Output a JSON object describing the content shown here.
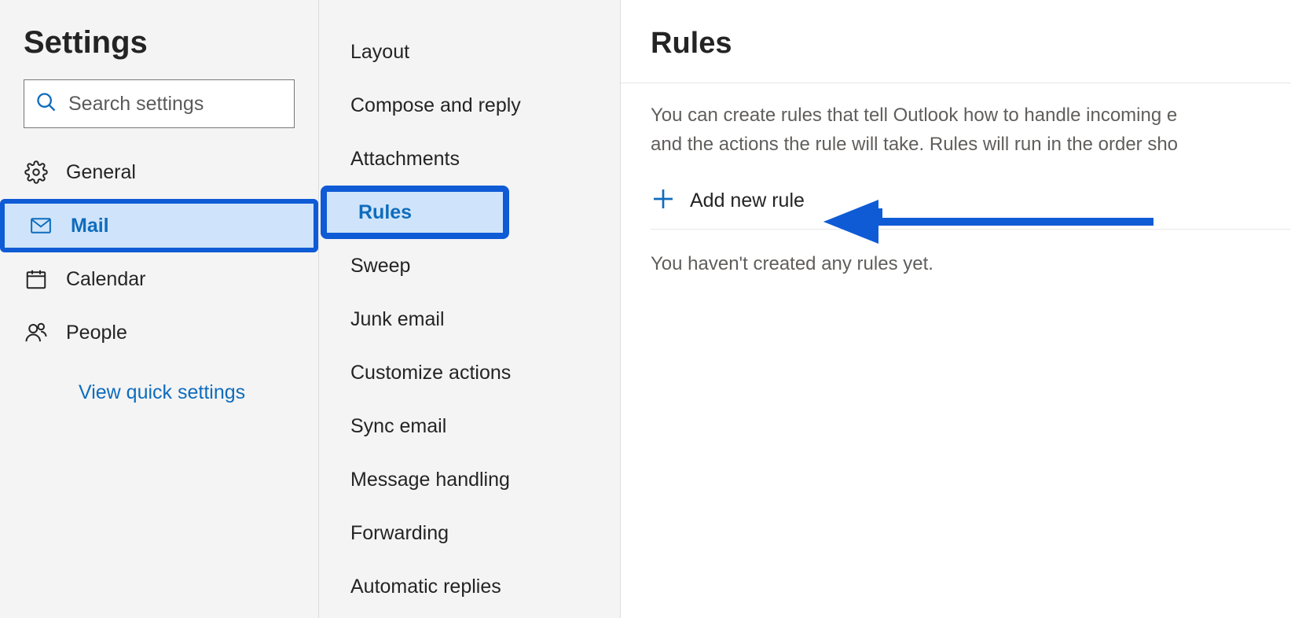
{
  "header": {
    "title": "Settings"
  },
  "search": {
    "placeholder": "Search settings"
  },
  "nav": {
    "items": [
      {
        "id": "general",
        "label": "General",
        "icon": "gear"
      },
      {
        "id": "mail",
        "label": "Mail",
        "icon": "mail",
        "selected": true
      },
      {
        "id": "calendar",
        "label": "Calendar",
        "icon": "calendar"
      },
      {
        "id": "people",
        "label": "People",
        "icon": "people"
      }
    ],
    "quick_link": "View quick settings"
  },
  "subnav": {
    "items": [
      {
        "id": "layout",
        "label": "Layout"
      },
      {
        "id": "compose-reply",
        "label": "Compose and reply"
      },
      {
        "id": "attachments",
        "label": "Attachments"
      },
      {
        "id": "rules",
        "label": "Rules",
        "selected": true
      },
      {
        "id": "sweep",
        "label": "Sweep"
      },
      {
        "id": "junk-email",
        "label": "Junk email"
      },
      {
        "id": "customize-actions",
        "label": "Customize actions"
      },
      {
        "id": "sync-email",
        "label": "Sync email"
      },
      {
        "id": "message-handling",
        "label": "Message handling"
      },
      {
        "id": "forwarding",
        "label": "Forwarding"
      },
      {
        "id": "automatic-replies",
        "label": "Automatic replies"
      }
    ]
  },
  "main": {
    "title": "Rules",
    "description_line1": "You can create rules that tell Outlook how to handle incoming e",
    "description_line2": "and the actions the rule will take. Rules will run in the order sho",
    "add_rule_label": "Add new rule",
    "empty_message": "You haven't created any rules yet."
  },
  "annotations": {
    "highlight_mail": true,
    "highlight_rules": true,
    "arrow_to_add_rule": true
  },
  "colors": {
    "accent": "#0f6cbd",
    "annotation": "#0f5bd6",
    "panel_bg": "#f4f4f4",
    "selection_bg": "#cfe4fa",
    "text_primary": "#242424",
    "text_secondary": "#605e5c"
  }
}
